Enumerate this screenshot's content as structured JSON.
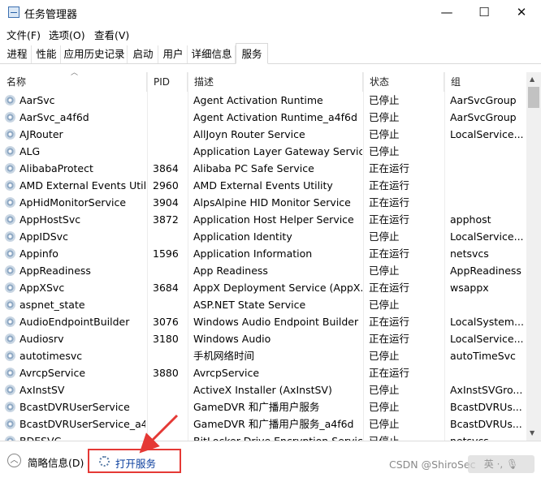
{
  "window": {
    "title": "任务管理器",
    "minimize": "—",
    "maximize": "☐",
    "close": "✕"
  },
  "menu": [
    "文件(F)",
    "选项(O)",
    "查看(V)"
  ],
  "tabs": [
    "进程",
    "性能",
    "应用历史记录",
    "启动",
    "用户",
    "详细信息",
    "服务"
  ],
  "active_tab": "服务",
  "columns": [
    "名称",
    "PID",
    "描述",
    "状态",
    "组"
  ],
  "sort_column": "名称",
  "rows": [
    {
      "name": "AarSvc",
      "pid": "",
      "desc": "Agent Activation Runtime",
      "status": "已停止",
      "group": "AarSvcGroup"
    },
    {
      "name": "AarSvc_a4f6d",
      "pid": "",
      "desc": "Agent Activation Runtime_a4f6d",
      "status": "已停止",
      "group": "AarSvcGroup"
    },
    {
      "name": "AJRouter",
      "pid": "",
      "desc": "AllJoyn Router Service",
      "status": "已停止",
      "group": "LocalService..."
    },
    {
      "name": "ALG",
      "pid": "",
      "desc": "Application Layer Gateway Service",
      "status": "已停止",
      "group": ""
    },
    {
      "name": "AlibabaProtect",
      "pid": "3864",
      "desc": "Alibaba PC Safe Service",
      "status": "正在运行",
      "group": ""
    },
    {
      "name": "AMD External Events Util...",
      "pid": "2960",
      "desc": "AMD External Events Utility",
      "status": "正在运行",
      "group": ""
    },
    {
      "name": "ApHidMonitorService",
      "pid": "3904",
      "desc": "AlpsAlpine HID Monitor Service",
      "status": "正在运行",
      "group": ""
    },
    {
      "name": "AppHostSvc",
      "pid": "3872",
      "desc": "Application Host Helper Service",
      "status": "正在运行",
      "group": "apphost"
    },
    {
      "name": "AppIDSvc",
      "pid": "",
      "desc": "Application Identity",
      "status": "已停止",
      "group": "LocalService..."
    },
    {
      "name": "Appinfo",
      "pid": "1596",
      "desc": "Application Information",
      "status": "正在运行",
      "group": "netsvcs"
    },
    {
      "name": "AppReadiness",
      "pid": "",
      "desc": "App Readiness",
      "status": "已停止",
      "group": "AppReadiness"
    },
    {
      "name": "AppXSvc",
      "pid": "3684",
      "desc": "AppX Deployment Service (AppX...",
      "status": "正在运行",
      "group": "wsappx"
    },
    {
      "name": "aspnet_state",
      "pid": "",
      "desc": "ASP.NET State Service",
      "status": "已停止",
      "group": ""
    },
    {
      "name": "AudioEndpointBuilder",
      "pid": "3076",
      "desc": "Windows Audio Endpoint Builder",
      "status": "正在运行",
      "group": "LocalSystem..."
    },
    {
      "name": "Audiosrv",
      "pid": "3180",
      "desc": "Windows Audio",
      "status": "正在运行",
      "group": "LocalService..."
    },
    {
      "name": "autotimesvc",
      "pid": "",
      "desc": "手机网络时间",
      "status": "已停止",
      "group": "autoTimeSvc"
    },
    {
      "name": "AvrcpService",
      "pid": "3880",
      "desc": "AvrcpService",
      "status": "正在运行",
      "group": ""
    },
    {
      "name": "AxInstSV",
      "pid": "",
      "desc": "ActiveX Installer (AxInstSV)",
      "status": "已停止",
      "group": "AxInstSVGro..."
    },
    {
      "name": "BcastDVRUserService",
      "pid": "",
      "desc": "GameDVR 和广播用户服务",
      "status": "已停止",
      "group": "BcastDVRUs..."
    },
    {
      "name": "BcastDVRUserService_a4...",
      "pid": "",
      "desc": "GameDVR 和广播用户服务_a4f6d",
      "status": "已停止",
      "group": "BcastDVRUs..."
    },
    {
      "name": "BDESVC",
      "pid": "",
      "desc": "BitLocker Drive Encryption Service",
      "status": "已停止",
      "group": "netsvcs"
    }
  ],
  "footer": {
    "fewer_details": "简略信息(D)",
    "open_services": "打开服务",
    "watermark": "CSDN @ShiroSec",
    "watermark_extra": "英 ·, 🎙"
  },
  "colors": {
    "highlight_box": "#e53935",
    "link": "#0a3e9e",
    "arrow": "#e53935"
  }
}
